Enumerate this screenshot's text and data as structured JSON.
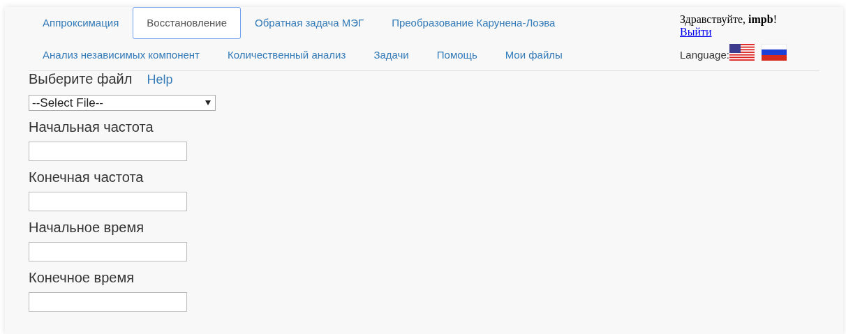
{
  "nav": {
    "main_tabs": [
      {
        "label": "Аппроксимация",
        "selected": false
      },
      {
        "label": "Восстановление",
        "selected": true
      },
      {
        "label": "Обратная задача МЭГ",
        "selected": false
      },
      {
        "label": "Преобразование Карунена-Лоэва",
        "selected": false
      }
    ],
    "more_tabs": [
      {
        "label": "Анализ независимых компонент",
        "selected": false
      },
      {
        "label": "Количественный анализ",
        "selected": false
      },
      {
        "label": "Задачи",
        "selected": false
      },
      {
        "label": "Помощь",
        "selected": false
      },
      {
        "label": "Мои файлы",
        "selected": false
      }
    ]
  },
  "user": {
    "greeting": "Здравствуйте, **impb**!",
    "logout": "Выйти ",
    "language_label": "Language:",
    "languages": [
      {
        "kind": "us"
      },
      {
        "kind": "ru"
      }
    ]
  },
  "form": {
    "file_label": "Выберите файл",
    "help": "Help",
    "file_select": "--Select File--",
    "fields": [
      {
        "label": "Начальная частота"
      },
      {
        "label": "Конечная частота"
      },
      {
        "label": "Начальное время"
      },
      {
        "label": "Конечное время"
      }
    ]
  }
}
